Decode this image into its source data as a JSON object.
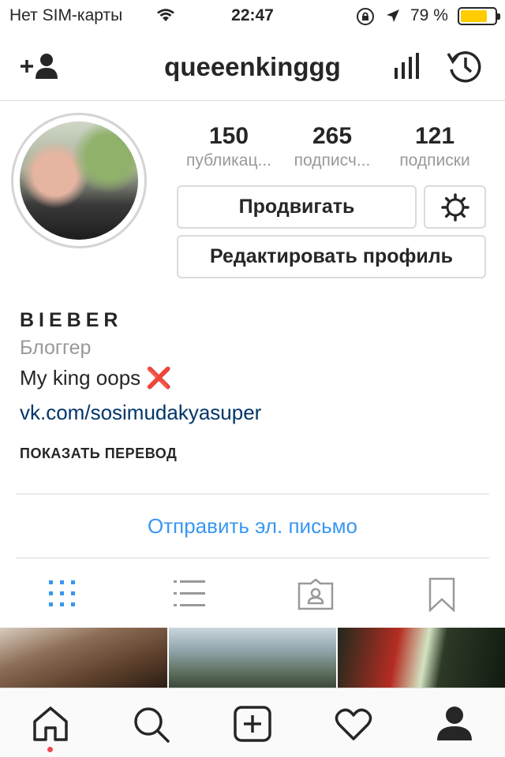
{
  "status_bar": {
    "carrier": "Нет SIM-карты",
    "time": "22:47",
    "battery_percent": "79 %",
    "battery_level": 0.79,
    "battery_color": "#ffcc00"
  },
  "header": {
    "username": "queeenkinggg"
  },
  "stats": [
    {
      "value": "150",
      "label": "публикац..."
    },
    {
      "value": "265",
      "label": "подписч..."
    },
    {
      "value": "121",
      "label": "подписки"
    }
  ],
  "buttons": {
    "promote": "Продвигать",
    "edit_profile": "Редактировать профиль"
  },
  "bio": {
    "name": "BIEBER",
    "category": "Блоггер",
    "text": "My king oops",
    "emoji": "❌",
    "link": "vk.com/sosimudakyasuper",
    "translate": "ПОКАЗАТЬ ПЕРЕВОД"
  },
  "email_button": "Отправить эл. письмо",
  "colors": {
    "link_blue": "#3897f0",
    "bio_link": "#003569",
    "notification_dot": "#ed4956"
  },
  "icons": {
    "header_left": "add-person-icon",
    "header_right": [
      "insights-icon",
      "archive-icon"
    ],
    "profile_tabs": [
      "grid-icon",
      "list-icon",
      "tagged-icon",
      "saved-icon"
    ],
    "bottom_tabs": [
      "home-icon",
      "search-icon",
      "add-post-icon",
      "activity-icon",
      "profile-icon"
    ]
  }
}
